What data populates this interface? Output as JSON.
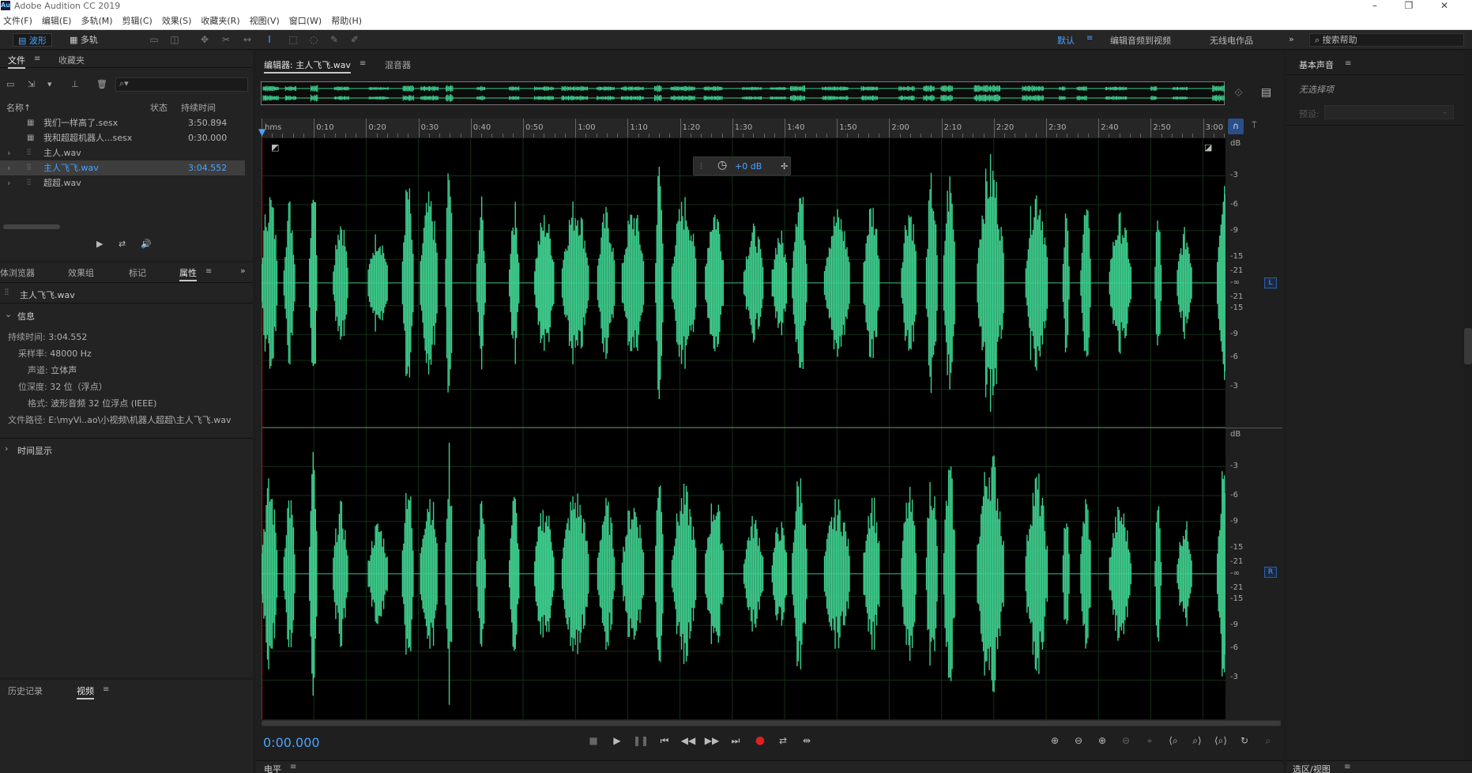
{
  "window": {
    "title": "Adobe Audition CC 2019",
    "logo": "Au"
  },
  "menu": [
    "文件(F)",
    "编辑(E)",
    "多轨(M)",
    "剪辑(C)",
    "效果(S)",
    "收藏夹(R)",
    "视图(V)",
    "窗口(W)",
    "帮助(H)"
  ],
  "toolbar": {
    "mode_waveform": "波形",
    "mode_multitrack": "多轨",
    "workspaces": [
      "默认",
      "编辑音频到视频",
      "无线电作品"
    ],
    "more": "»",
    "search_placeholder": "搜索帮助"
  },
  "files_panel": {
    "tabs": [
      "文件",
      "收藏夹"
    ],
    "columns": {
      "name": "名称",
      "status": "状态",
      "duration": "持续时间"
    },
    "rows": [
      {
        "name": "我们一样高了.sesx",
        "duration": "3:50.894",
        "type": "session-icon",
        "expand": ""
      },
      {
        "name": "我和超超机器人...sesx",
        "duration": "0:30.000",
        "type": "session-icon",
        "expand": ""
      },
      {
        "name": "主人.wav",
        "duration": "",
        "type": "waveform-icon",
        "expand": "›"
      },
      {
        "name": "主人飞飞.wav",
        "duration": "3:04.552",
        "type": "waveform-icon",
        "expand": "›",
        "selected": true
      },
      {
        "name": "超超.wav",
        "duration": "",
        "type": "waveform-icon",
        "expand": "›"
      }
    ]
  },
  "props_panel": {
    "tabs": [
      "体浏览器",
      "效果组",
      "标记",
      "属性"
    ],
    "file_name": "主人飞飞.wav",
    "section_info": "信息",
    "info": [
      {
        "k": "持续时间:",
        "v": "3:04.552"
      },
      {
        "k": "采样率:",
        "v": "48000 Hz"
      },
      {
        "k": "声道:",
        "v": "立体声"
      },
      {
        "k": "位深度:",
        "v": "32 位（浮点）"
      },
      {
        "k": "格式:",
        "v": "波形音频 32 位浮点 (IEEE)"
      },
      {
        "k": "文件路径:",
        "v": "E:\\myVi..ao\\小视频\\机器人超超\\主人飞飞.wav"
      }
    ],
    "section_time": "时间显示"
  },
  "history_panel": {
    "tabs": [
      "历史记录",
      "视频"
    ]
  },
  "editor": {
    "tabs": [
      "编辑器: 主人飞飞.wav",
      "混音器"
    ],
    "ruler_unit": "hms",
    "ruler_labels": [
      "0:10",
      "0:20",
      "0:30",
      "0:40",
      "0:50",
      "1:00",
      "1:10",
      "1:20",
      "1:30",
      "1:40",
      "1:50",
      "2:00",
      "2:10",
      "2:20",
      "2:30",
      "2:40",
      "2:50",
      "3:00"
    ],
    "hud_gain": "+0 dB",
    "db_labels": [
      "dB",
      "-3",
      "-6",
      "-9",
      "-15",
      "-21",
      "-∞",
      "-21",
      "-15",
      "-9",
      "-6",
      "-3"
    ],
    "channel_left": "L",
    "channel_right": "R",
    "time_display": "0:00.000"
  },
  "right_panel": {
    "title": "基本声音",
    "no_selection": "无选择项",
    "preset_label": "预设:"
  },
  "bottom": {
    "level": "电平",
    "selection": "选区/视图"
  },
  "colors": {
    "waveform": "#3ecf8e",
    "accent": "#4aa3ff",
    "record": "#e02020"
  }
}
